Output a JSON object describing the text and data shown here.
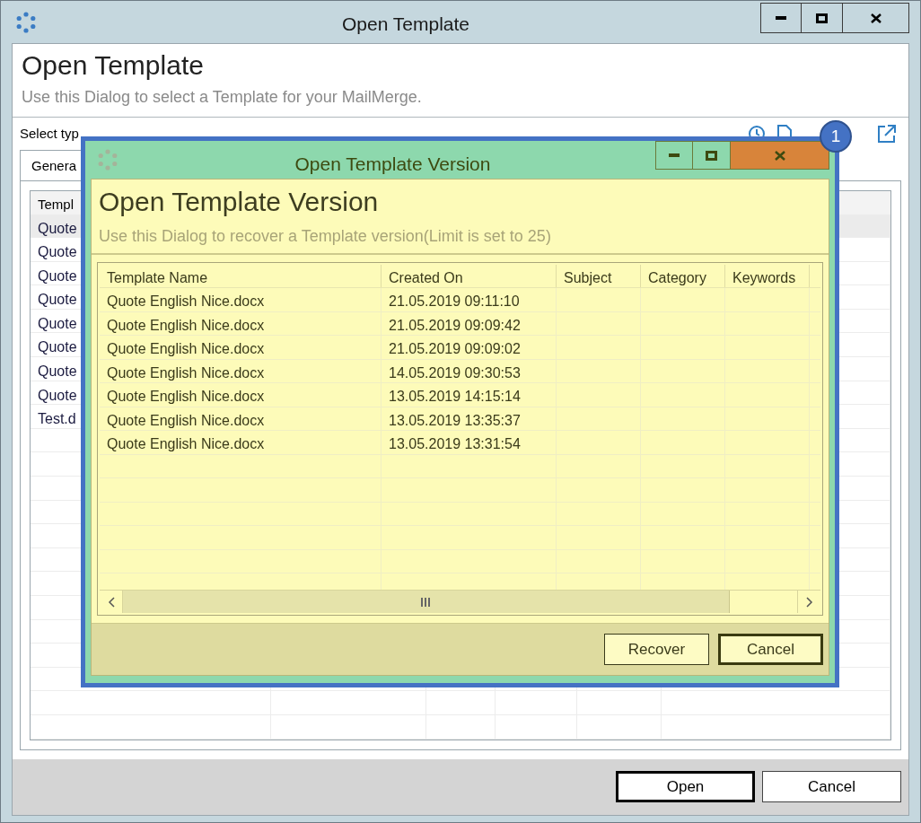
{
  "window": {
    "title": "Open Template"
  },
  "header": {
    "title": "Open Template",
    "subtitle": "Use this Dialog to select a Template for your MailMerge."
  },
  "filter": {
    "label": "Select typ"
  },
  "tabs": [
    {
      "label": "Genera",
      "selected": true
    }
  ],
  "table": {
    "columns": [
      "Templ"
    ],
    "rows": [
      {
        "name": "Quote",
        "selected": true
      },
      {
        "name": "Quote",
        "selected": false
      },
      {
        "name": "Quote",
        "selected": false
      },
      {
        "name": "Quote",
        "selected": false
      },
      {
        "name": "Quote",
        "selected": false
      },
      {
        "name": "Quote",
        "selected": false
      },
      {
        "name": "Quote",
        "selected": false
      },
      {
        "name": "Quote",
        "selected": false
      },
      {
        "name": "Test.d",
        "selected": false
      }
    ]
  },
  "buttons": [
    {
      "label": "Open",
      "default": true
    },
    {
      "label": "Cancel",
      "default": false
    }
  ],
  "badge": "1",
  "version_dialog": {
    "title": "Open Template Version",
    "heading": "Open Template Version",
    "subtitle": "Use this Dialog to recover a Template version(Limit is set to 25)",
    "columns": [
      "Template Name",
      "Created On",
      "Subject",
      "Category",
      "Keywords"
    ],
    "rows": [
      {
        "name": "Quote English Nice.docx",
        "created_on": "21.05.2019 09:11:10"
      },
      {
        "name": "Quote English Nice.docx",
        "created_on": "21.05.2019 09:09:42"
      },
      {
        "name": "Quote English Nice.docx",
        "created_on": "21.05.2019 09:09:02"
      },
      {
        "name": "Quote English Nice.docx",
        "created_on": "14.05.2019 09:30:53"
      },
      {
        "name": "Quote English Nice.docx",
        "created_on": "13.05.2019 14:15:14"
      },
      {
        "name": "Quote English Nice.docx",
        "created_on": "13.05.2019 13:35:37"
      },
      {
        "name": "Quote English Nice.docx",
        "created_on": "13.05.2019 13:31:54"
      }
    ],
    "buttons": [
      {
        "label": "Recover",
        "default": false
      },
      {
        "label": "Cancel",
        "default": true
      }
    ]
  }
}
